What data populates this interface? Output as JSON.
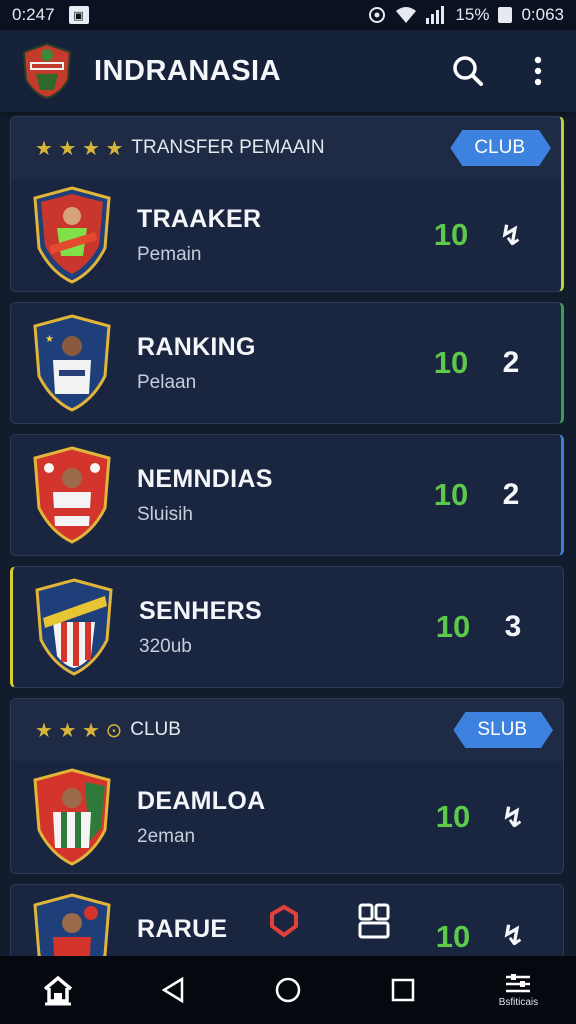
{
  "status_bar": {
    "time": "0:247",
    "notification_icon": "image-icon",
    "battery": "15%",
    "right_time": "0:063"
  },
  "header": {
    "title": "INDRANASIA",
    "search_icon": "search-icon",
    "menu_icon": "more-vert-icon"
  },
  "sections": [
    {
      "head": {
        "stars": "★ ★ ★ ★",
        "label": "TRANSFER PEMAAIN",
        "badge": "CLUB"
      },
      "row": {
        "name": "TRAAKER",
        "sub": "Pemain",
        "score": "10",
        "rank": "↯"
      }
    },
    {
      "row": {
        "name": "RANKING",
        "sub": "Pelaan",
        "score": "10",
        "rank": "2"
      }
    },
    {
      "row": {
        "name": "NEMNDIAS",
        "sub": "Sluisih",
        "score": "10",
        "rank": "2"
      }
    },
    {
      "row": {
        "name": "SENHERS",
        "sub": "320ub",
        "score": "10",
        "rank": "3"
      }
    },
    {
      "head": {
        "stars": "★ ★ ★ ⊙",
        "label": "CLUB",
        "badge": "SLUB"
      },
      "row": {
        "name": "DEAMLOA",
        "sub": "2eman",
        "score": "10",
        "rank": "↯"
      }
    },
    {
      "row": {
        "name": "RARUE",
        "sub": "",
        "score": "10",
        "rank": "↯"
      }
    }
  ],
  "bottom_nav": {
    "last_label": "Bsfiticais"
  },
  "colors": {
    "accent_green": "#5cc94a",
    "badge_blue": "#3c82de",
    "star_gold": "#d7b53a"
  }
}
